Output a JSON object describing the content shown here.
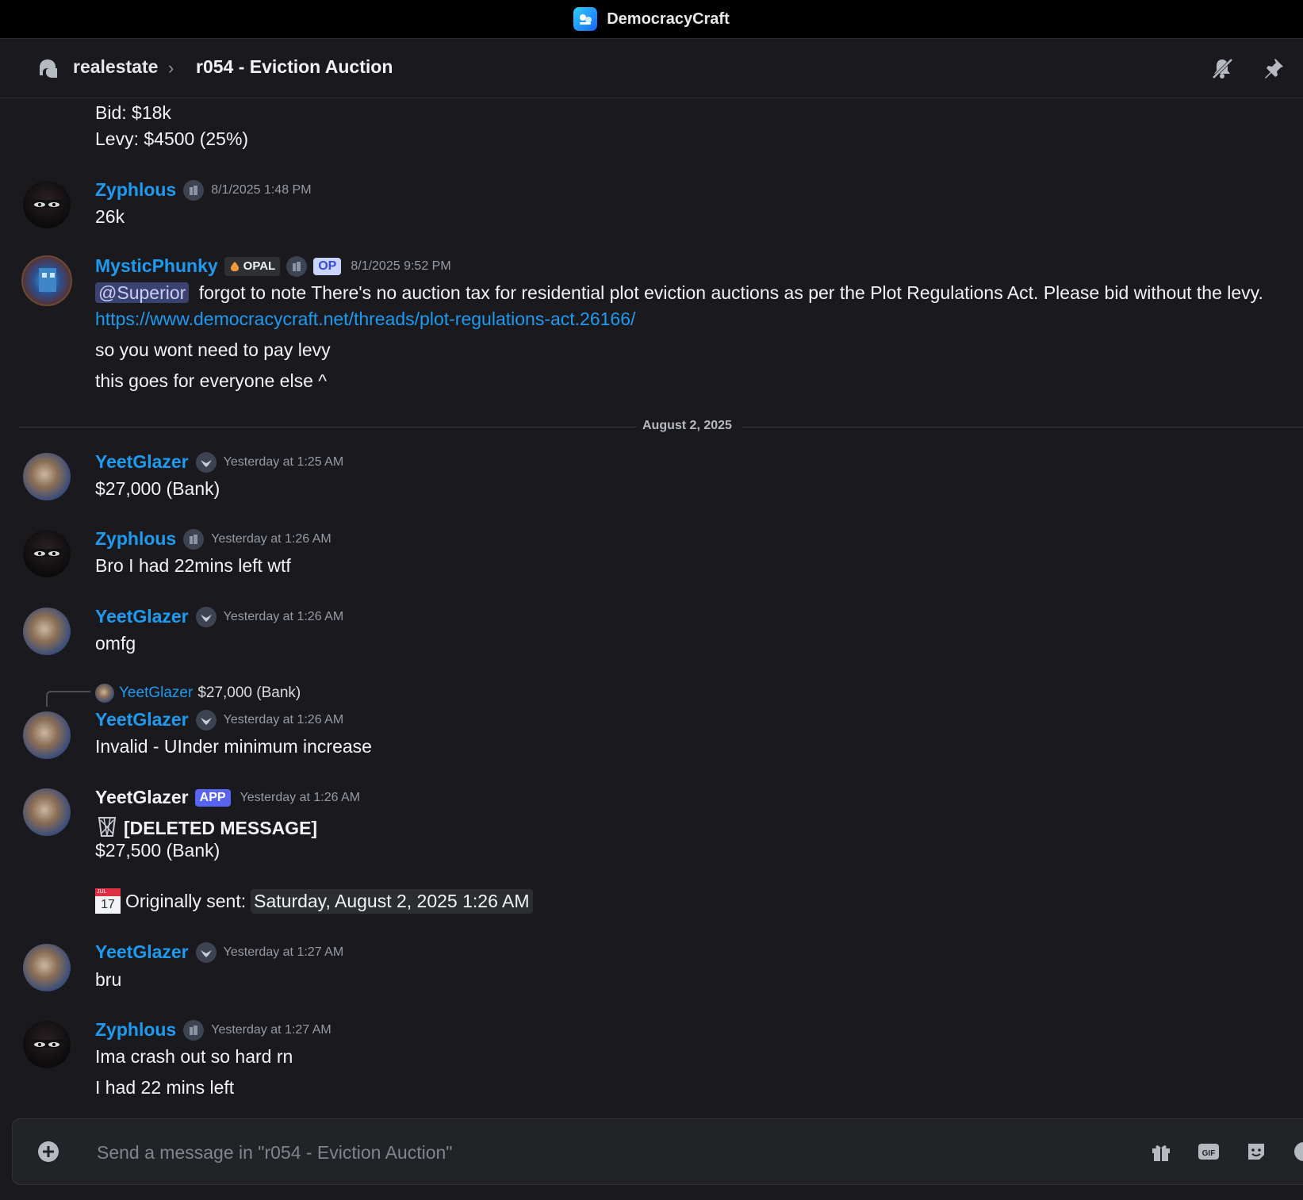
{
  "window": {
    "server_name": "DemocracyCraft"
  },
  "header": {
    "parent_channel": "realestate",
    "thread_title": "r054 - Eviction Auction"
  },
  "messages": [
    {
      "continuation": true,
      "lines": [
        "Bid: $18k",
        "Levy:  $4500 (25%)"
      ]
    },
    {
      "author": "Zyphlous",
      "timestamp": "8/1/2025 1:48 PM",
      "lines": [
        "26k"
      ]
    },
    {
      "author": "MysticPhunky",
      "tags": {
        "opal": "OPAL",
        "op": "OP"
      },
      "timestamp": "8/1/2025 9:52 PM",
      "mention": "@Superior",
      "text_after_mention": "forgot to note There's no auction tax for residential plot eviction auctions as per the Plot Regulations Act. Please bid without the levy.",
      "link": "https://www.democracycraft.net/threads/plot-regulations-act.26166/",
      "lines": [
        "so you wont need to pay levy",
        "this goes for everyone else ^"
      ]
    },
    {
      "author": "YeetGlazer",
      "timestamp": "Yesterday at 1:25 AM",
      "lines": [
        "$27,000 (Bank)"
      ]
    },
    {
      "author": "Zyphlous",
      "timestamp": "Yesterday at 1:26 AM",
      "lines": [
        "Bro I had 22mins left wtf"
      ]
    },
    {
      "author": "YeetGlazer",
      "timestamp": "Yesterday at 1:26 AM",
      "lines": [
        "omfg"
      ]
    },
    {
      "author": "YeetGlazer",
      "timestamp": "Yesterday at 1:26 AM",
      "reply": {
        "author": "YeetGlazer",
        "text": "$27,000 (Bank)"
      },
      "lines": [
        "Invalid - UInder minimum increase"
      ]
    },
    {
      "author": "YeetGlazer",
      "tag": "APP",
      "timestamp": "Yesterday at 1:26 AM",
      "deleted_label": "[DELETED MESSAGE]",
      "deleted_content": "$27,500 (Bank)",
      "calendar_day": "17",
      "calendar_month": "JUL",
      "originally_sent_label": "Originally sent:",
      "originally_sent_value": "Saturday, August 2, 2025 1:26 AM"
    },
    {
      "author": "YeetGlazer",
      "timestamp": "Yesterday at 1:27 AM",
      "lines": [
        "bru"
      ]
    },
    {
      "author": "Zyphlous",
      "timestamp": "Yesterday at 1:27 AM",
      "lines": [
        "Ima crash out so hard rn",
        "I had 22 mins left"
      ]
    }
  ],
  "date_divider": "August 2, 2025",
  "composer": {
    "placeholder": "Send a message in \"r054 - Eviction Auction\"",
    "icons": [
      "plus-icon",
      "gift-icon",
      "gif-icon",
      "sticker-icon",
      "emoji-icon"
    ],
    "gif_label": "GIF"
  },
  "colors": {
    "link": "#1e9bf0",
    "background": "#1a1a1e",
    "app_tag": "#5865f2"
  }
}
